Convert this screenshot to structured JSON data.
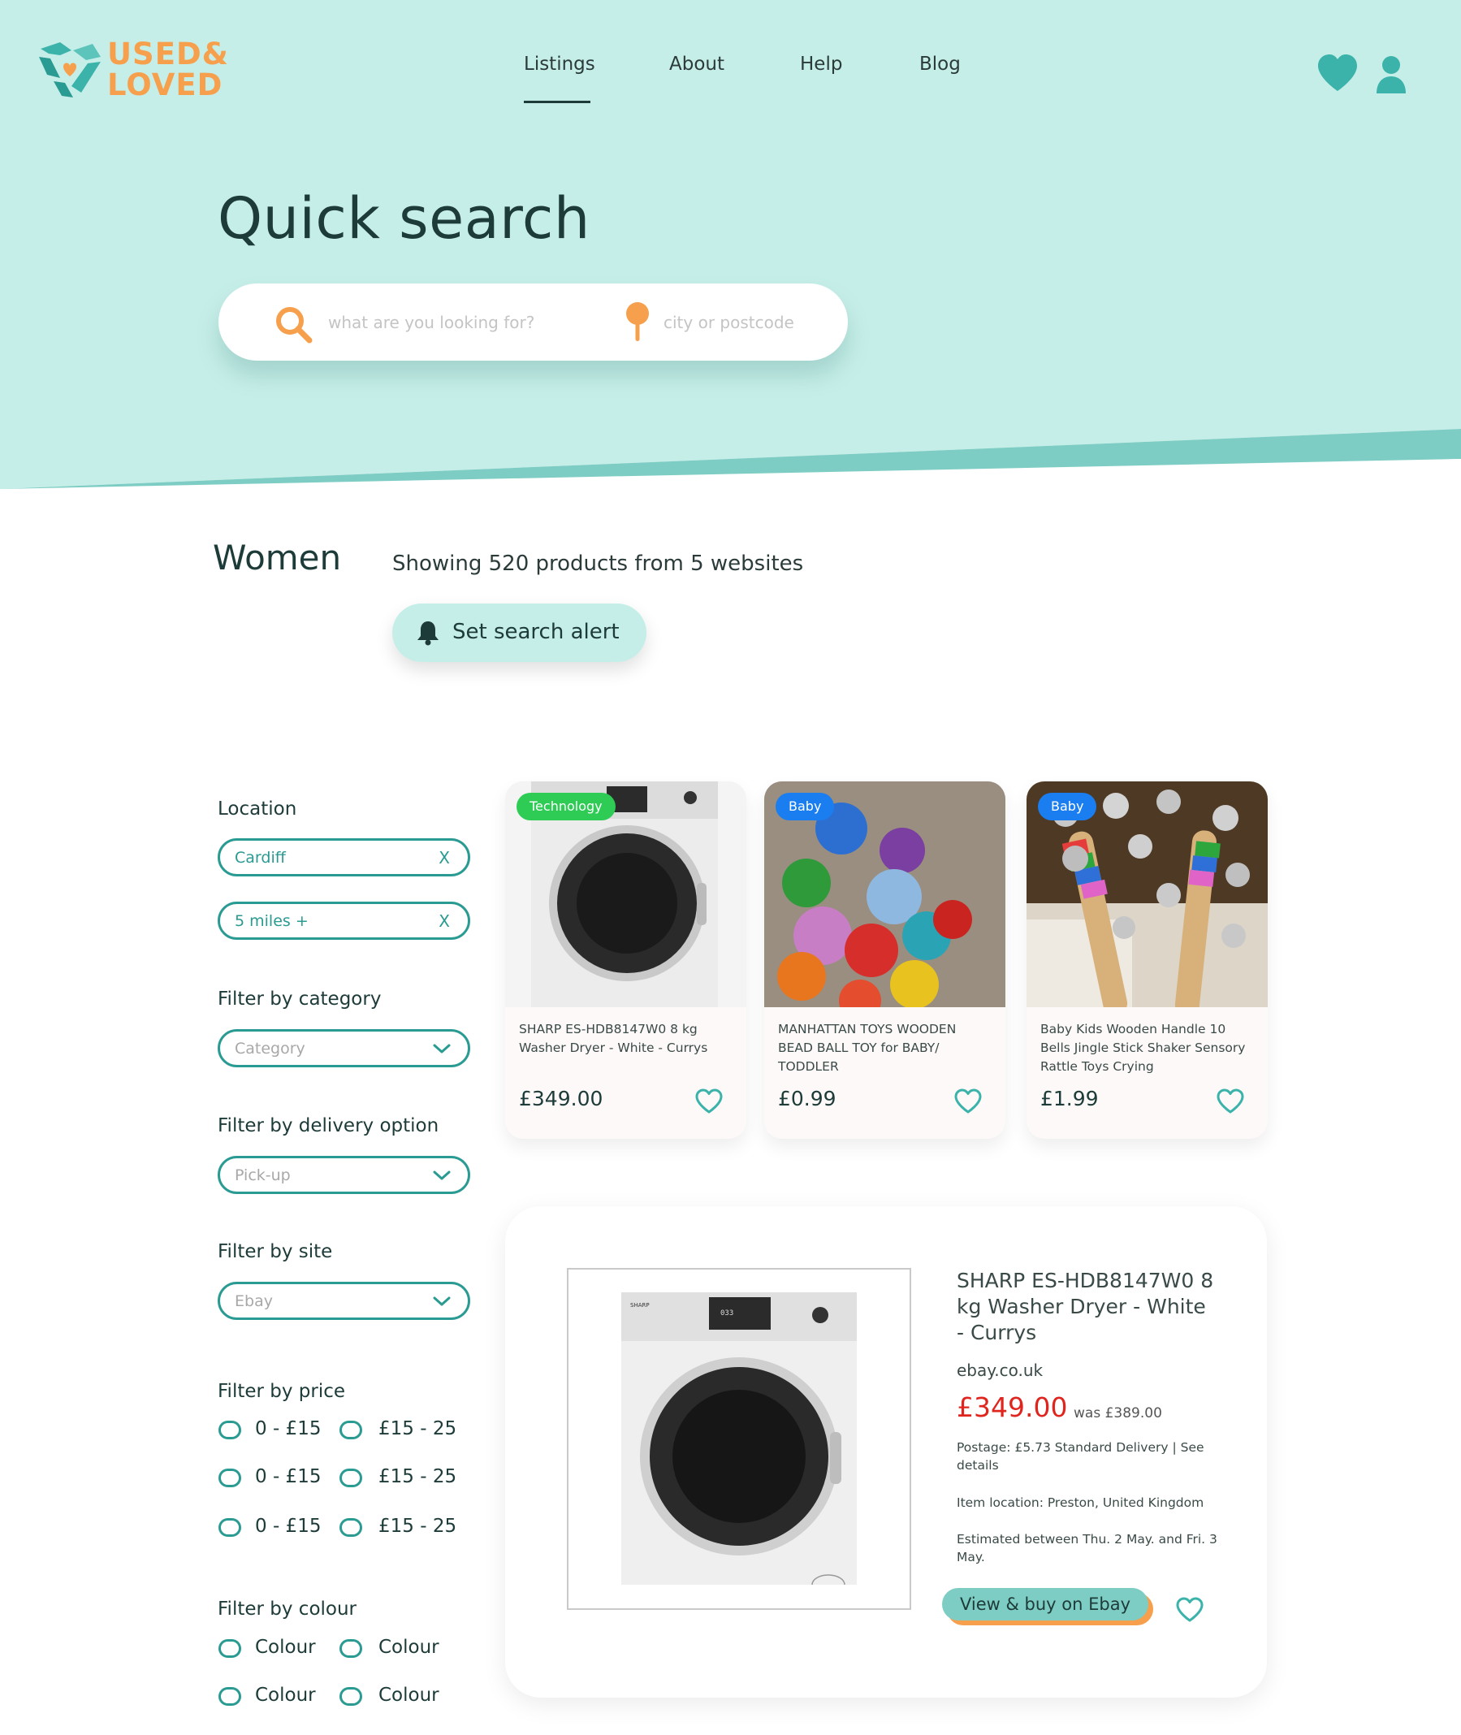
{
  "brand": {
    "line1": "USED&",
    "line2": "LOVED",
    "color": "#f6a04d",
    "accent": "#3bb3aa"
  },
  "nav": {
    "items": [
      "Listings",
      "About",
      "Help",
      "Blog"
    ],
    "active": "Listings"
  },
  "header_icons": [
    "heart-icon",
    "user-icon"
  ],
  "hero": {
    "title": "Quick search",
    "search_placeholder": "what are you looking for?",
    "location_placeholder": "city or postcode",
    "bg": "#c6eee8"
  },
  "results": {
    "category": "Women",
    "count_text": "Showing 520 products from 5 websites",
    "alert_label": "Set search alert"
  },
  "filters": {
    "location_label": "Location",
    "location_value": "Cardiff",
    "radius_value": "5 miles +",
    "clear_symbol": "X",
    "category_label": "Filter by category",
    "category_placeholder": "Category",
    "delivery_label": "Filter by delivery option",
    "delivery_placeholder": "Pick-up",
    "site_label": "Filter by site",
    "site_placeholder": "Ebay",
    "price_label": "Filter by price",
    "price_options": [
      "0 - £15",
      "£15 - 25",
      "0 - £15",
      "£15 - 25",
      "0 - £15",
      "£15 - 25"
    ],
    "colour_label": "Filter by colour",
    "colour_options": [
      "Colour",
      "Colour",
      "Colour",
      "Colour"
    ]
  },
  "products": [
    {
      "badge": "Technology",
      "badge_color": "#2ecc55",
      "title": "SHARP ES-HDB8147W0 8 kg Washer Dryer - White - Currys",
      "price": "£349.00"
    },
    {
      "badge": "Baby",
      "badge_color": "#1a7ef0",
      "title": "MANHATTAN TOYS WOODEN BEAD BALL TOY for BABY/ TODDLER",
      "price": "£0.99"
    },
    {
      "badge": "Baby",
      "badge_color": "#1a7ef0",
      "title": "Baby Kids Wooden Handle 10 Bells Jingle Stick Shaker Sensory Rattle Toys Crying",
      "price": "£1.99"
    }
  ],
  "detail": {
    "title": "SHARP ES-HDB8147W0 8 kg Washer Dryer - White - Currys",
    "site": "ebay.co.uk",
    "price": "£349.00",
    "was_price": "was £389.00",
    "postage": "Postage: £5.73 Standard Delivery | See details",
    "location": "Item location: Preston, United Kingdom",
    "estimate": "Estimated between Thu. 2 May. and Fri. 3 May.",
    "cta": "View & buy on Ebay",
    "machine_display": "033",
    "machine_brand": "SHARP"
  }
}
